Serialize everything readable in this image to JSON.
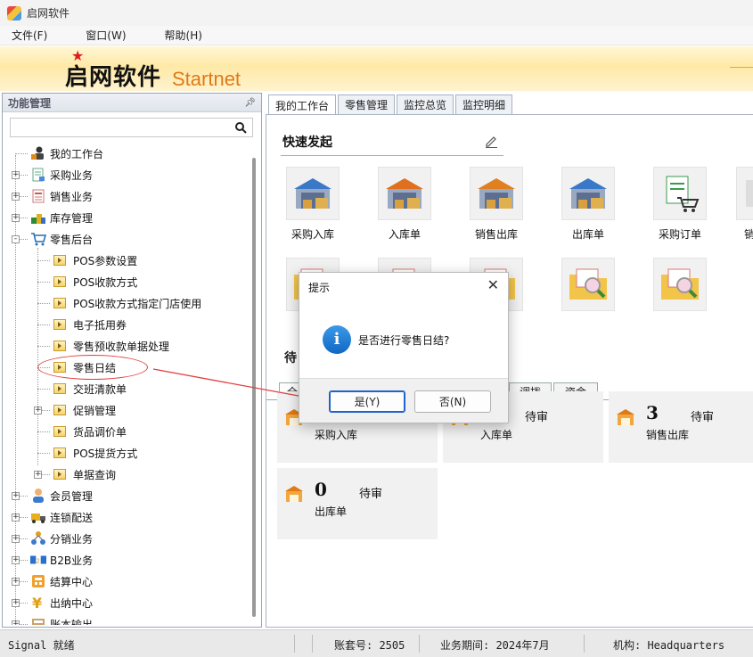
{
  "window": {
    "title": "启网软件"
  },
  "menu": [
    "文件(F)",
    "窗口(W)",
    "帮助(H)"
  ],
  "banner": {
    "brand_cn": "启网软件",
    "brand_en": "Startnet"
  },
  "left_panel": {
    "title": "功能管理",
    "search_placeholder": "",
    "tree": [
      {
        "label": "我的工作台",
        "level": 0,
        "icon": "user-desk-icon",
        "expander": ""
      },
      {
        "label": "采购业务",
        "level": 0,
        "icon": "purchase-icon",
        "expander": "+"
      },
      {
        "label": "销售业务",
        "level": 0,
        "icon": "sales-icon",
        "expander": "+"
      },
      {
        "label": "库存管理",
        "level": 0,
        "icon": "inventory-icon",
        "expander": "+"
      },
      {
        "label": "零售后台",
        "level": 0,
        "icon": "retail-cart-icon",
        "expander": "-"
      },
      {
        "label": "POS参数设置",
        "level": 1,
        "expander": ""
      },
      {
        "label": "POS收款方式",
        "level": 1,
        "expander": ""
      },
      {
        "label": "POS收款方式指定门店使用",
        "level": 1,
        "expander": ""
      },
      {
        "label": "电子抵用券",
        "level": 1,
        "expander": ""
      },
      {
        "label": "零售预收款单据处理",
        "level": 1,
        "expander": ""
      },
      {
        "label": "零售日结",
        "level": 1,
        "expander": ""
      },
      {
        "label": "交班清款单",
        "level": 1,
        "expander": ""
      },
      {
        "label": "促销管理",
        "level": 1,
        "expander": "+"
      },
      {
        "label": "货品调价单",
        "level": 1,
        "expander": ""
      },
      {
        "label": "POS提货方式",
        "level": 1,
        "expander": ""
      },
      {
        "label": "单据查询",
        "level": 1,
        "expander": "+"
      },
      {
        "label": "会员管理",
        "level": 0,
        "icon": "member-icon",
        "expander": "+"
      },
      {
        "label": "连锁配送",
        "level": 0,
        "icon": "delivery-truck-icon",
        "expander": "+"
      },
      {
        "label": "分销业务",
        "level": 0,
        "icon": "distribution-icon",
        "expander": "+"
      },
      {
        "label": "B2B业务",
        "level": 0,
        "icon": "b2b-icon",
        "expander": "+"
      },
      {
        "label": "结算中心",
        "level": 0,
        "icon": "settlement-icon",
        "expander": "+"
      },
      {
        "label": "出纳中心",
        "level": 0,
        "icon": "cashier-yen-icon",
        "expander": "+"
      },
      {
        "label": "账本输出",
        "level": 0,
        "icon": "ledger-icon",
        "expander": "+"
      }
    ]
  },
  "tabs": [
    "我的工作台",
    "零售管理",
    "监控总览",
    "监控明细"
  ],
  "quick_start": {
    "title": "快速发起",
    "items": [
      {
        "label": "采购入库",
        "icon": "warehouse-cart-icon"
      },
      {
        "label": "入库单",
        "icon": "warehouse-forklift-icon"
      },
      {
        "label": "销售出库",
        "icon": "warehouse-truck-icon"
      },
      {
        "label": "出库单",
        "icon": "warehouse-forklift-out-icon"
      },
      {
        "label": "采购订单",
        "icon": "order-cart-icon"
      },
      {
        "label": "销",
        "icon": "partial-icon"
      }
    ],
    "row2_icons": [
      "folder-doc-icon",
      "folder-doc-icon",
      "folder-doc-icon",
      "folder-search-icon",
      "folder-search-icon"
    ]
  },
  "todo": {
    "title": "待",
    "subtabs": [
      "全",
      "调拨",
      "资金"
    ],
    "cards": [
      {
        "num": "",
        "status": "",
        "name": "采购入库"
      },
      {
        "num": "",
        "status": "待审",
        "name": "入库单"
      },
      {
        "num": "3",
        "status": "待审",
        "name": "销售出库"
      },
      {
        "num": "0",
        "status": "待审",
        "name": "出库单"
      }
    ]
  },
  "dialog": {
    "title": "提示",
    "message": "是否进行零售日结?",
    "yes": "是(Y)",
    "no": "否(N)"
  },
  "status": {
    "signal": "Signal 就绪",
    "account": "账套号: 2505",
    "period": "业务期间: 2024年7月",
    "org": "机构: Headquarters"
  },
  "colors": {
    "accent": "#f0a040",
    "annotation": "#e04040",
    "dialog_primary": "#1e64c8"
  }
}
